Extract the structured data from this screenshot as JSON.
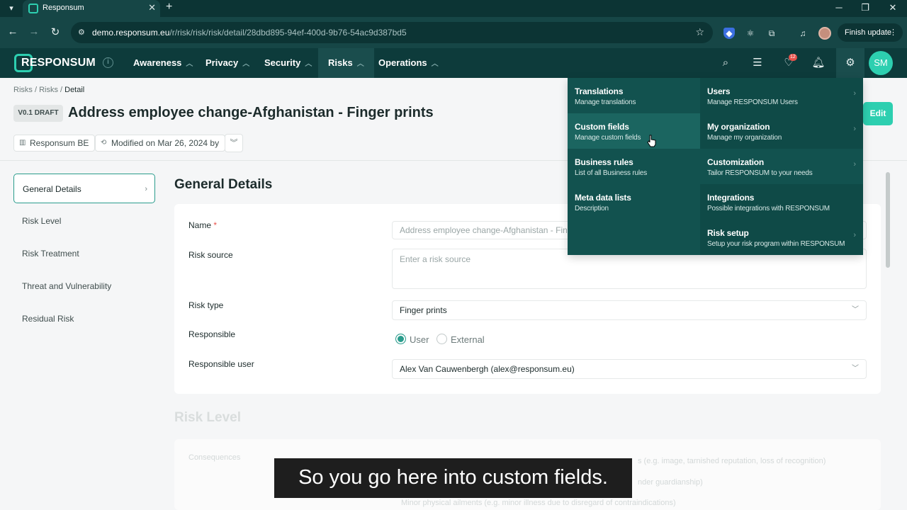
{
  "browser": {
    "tab_title": "Responsum",
    "url_host": "demo.responsum.eu",
    "url_path": "/r/risk/risk/risk/detail/28dbd895-94ef-400d-9b76-54ac9d387bd5",
    "finish_update": "Finish update"
  },
  "app": {
    "logo": "RESPONSUM",
    "menu": [
      "Awareness",
      "Privacy",
      "Security",
      "Risks",
      "Operations"
    ],
    "active_menu": "Risks",
    "notification_badge": "12",
    "avatar_initials": "SM",
    "accent_color": "#2dcfb0",
    "header_color": "#0d3b3b"
  },
  "page": {
    "breadcrumb": [
      "Risks",
      "Risks",
      "Detail"
    ],
    "version": "V0.1 DRAFT",
    "title": "Address employee change-Afghanistan - Finger prints",
    "owner_chip": "Responsum BE",
    "modified_chip": "Modified on Mar 26, 2024 by",
    "edit_label": "Edit"
  },
  "sidebar": {
    "items": [
      "General Details",
      "Risk Level",
      "Risk Treatment",
      "Threat and Vulnerability",
      "Residual Risk"
    ],
    "active": "General Details"
  },
  "form": {
    "section_title": "General Details",
    "name_label": "Name",
    "name_value": "Address employee change-Afghanistan - Finger prints",
    "risk_source_label": "Risk source",
    "risk_source_placeholder": "Enter a risk source",
    "risk_type_label": "Risk type",
    "risk_type_value": "Finger prints",
    "responsible_label": "Responsible",
    "responsible_options": [
      "User",
      "External"
    ],
    "responsible_selected": "User",
    "responsible_user_label": "Responsible user",
    "responsible_user_value": "Alex Van Cauwenbergh (alex@responsum.eu)"
  },
  "faded": {
    "section_title": "Risk Level",
    "consequences_label": "Consequences",
    "line1": "s (e.g. image, tarnished reputation, loss of recognition)",
    "line2": "nder guardianship)",
    "line3": "Minor physical ailments (e.g. minor illness due to disregard of contraindications)"
  },
  "settings_menu": {
    "left": [
      {
        "title": "Translations",
        "desc": "Manage translations"
      },
      {
        "title": "Custom fields",
        "desc": "Manage custom fields"
      },
      {
        "title": "Business rules",
        "desc": "List of all Business rules"
      },
      {
        "title": "Meta data lists",
        "desc": "Description"
      }
    ],
    "right": [
      {
        "title": "Users",
        "desc": "Manage RESPONSUM Users"
      },
      {
        "title": "My organization",
        "desc": "Manage my organization"
      },
      {
        "title": "Customization",
        "desc": "Tailor RESPONSUM to your needs"
      },
      {
        "title": "Integrations",
        "desc": "Possible integrations with RESPONSUM"
      },
      {
        "title": "Risk setup",
        "desc": "Setup your risk program within RESPONSUM"
      }
    ],
    "hovered": "Custom fields"
  },
  "caption": "So you go here into custom fields."
}
